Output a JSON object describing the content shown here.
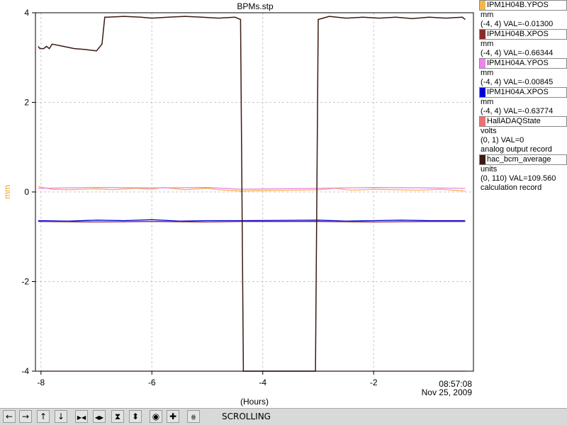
{
  "window": {
    "title": "BPMs.stp"
  },
  "chart_data": {
    "type": "line",
    "title": "BPMs.stp",
    "xlabel": "(Hours)",
    "ylabel": "mm",
    "xlim": [
      -8.1,
      -0.2
    ],
    "ylim": [
      -4,
      4
    ],
    "x_ticks": [
      "-8",
      "-6",
      "-4",
      "-2"
    ],
    "y_ticks": [
      "4",
      "2",
      "0",
      "-2",
      "-4"
    ],
    "time_label": "08:57:08",
    "date_label": "Nov 25, 2009",
    "grid": true,
    "series": [
      {
        "name": "IPM1H04B.YPOS",
        "color": "#f4b84a",
        "x": [
          -8.05,
          -7.8,
          -7.5,
          -7.0,
          -6.7,
          -6.3,
          -6.0,
          -5.8,
          -5.4,
          -5.0,
          -4.8,
          -4.4,
          -3.0,
          -2.7,
          -2.4,
          -2.0,
          -1.6,
          -1.2,
          -0.8,
          -0.35
        ],
        "y": [
          0.12,
          0.06,
          0.05,
          0.07,
          0.05,
          0.08,
          0.06,
          0.1,
          0.05,
          0.08,
          0.05,
          0.02,
          0.05,
          0.08,
          0.04,
          0.06,
          0.05,
          0.04,
          0.06,
          0.02
        ]
      },
      {
        "name": "IPM1H04B.XPOS",
        "color": "#8b2a2a",
        "x": [
          -8.05,
          -7.0,
          -6.0,
          -5.0,
          -4.4,
          -3.0,
          -2.0,
          -1.0,
          -0.35
        ],
        "y": [
          -0.66,
          -0.67,
          -0.66,
          -0.67,
          -0.66,
          -0.66,
          -0.67,
          -0.66,
          -0.66
        ]
      },
      {
        "name": "IPM1H04A.YPOS",
        "color": "#ee82ee",
        "x": [
          -8.05,
          -7.0,
          -6.0,
          -5.0,
          -4.4,
          -3.0,
          -2.0,
          -1.0,
          -0.35
        ],
        "y": [
          0.08,
          0.1,
          0.09,
          0.1,
          0.06,
          0.08,
          0.1,
          0.09,
          0.08
        ]
      },
      {
        "name": "IPM1H04A.XPOS",
        "color": "#0000dd",
        "x": [
          -8.05,
          -7.5,
          -7.0,
          -6.5,
          -6.0,
          -5.5,
          -5.0,
          -4.4,
          -3.0,
          -2.5,
          -2.0,
          -1.5,
          -1.0,
          -0.35
        ],
        "y": [
          -0.64,
          -0.65,
          -0.63,
          -0.64,
          -0.62,
          -0.65,
          -0.64,
          -0.64,
          -0.63,
          -0.65,
          -0.64,
          -0.63,
          -0.64,
          -0.64
        ]
      },
      {
        "name": "HallADAQState",
        "color": "#f07070",
        "x": [
          -8.05,
          -0.35
        ],
        "y": [
          -4,
          -4
        ]
      },
      {
        "name": "hac_bcm_average",
        "color": "#3a1a14",
        "x": [
          -8.05,
          -8.02,
          -7.95,
          -7.9,
          -7.85,
          -7.8,
          -7.6,
          -7.4,
          -7.2,
          -7.0,
          -6.9,
          -6.85,
          -6.8,
          -6.5,
          -6.2,
          -6.0,
          -5.7,
          -5.4,
          -5.1,
          -4.8,
          -4.5,
          -4.4,
          -4.35,
          -3.5,
          -3.05,
          -3.0,
          -2.8,
          -2.5,
          -2.2,
          -1.9,
          -1.6,
          -1.3,
          -1.0,
          -0.7,
          -0.4,
          -0.35
        ],
        "y": [
          3.25,
          3.2,
          3.2,
          3.25,
          3.2,
          3.3,
          3.25,
          3.2,
          3.18,
          3.15,
          3.3,
          3.9,
          3.9,
          3.92,
          3.9,
          3.88,
          3.9,
          3.92,
          3.9,
          3.88,
          3.9,
          3.85,
          -4,
          -4,
          -4,
          3.85,
          3.92,
          3.88,
          3.9,
          3.88,
          3.9,
          3.87,
          3.9,
          3.88,
          3.9,
          3.85
        ]
      }
    ]
  },
  "legend": {
    "entries": [
      {
        "name": "IPM1H04B.YPOS",
        "color": "#f4b84a",
        "lines": [
          "mm",
          "(-4, 4) VAL=-0.01300"
        ]
      },
      {
        "name": "IPM1H04B.XPOS",
        "color": "#8b2a2a",
        "lines": [
          "mm",
          "(-4, 4) VAL=-0.66344"
        ]
      },
      {
        "name": "IPM1H04A.YPOS",
        "color": "#ee82ee",
        "lines": [
          "mm",
          "(-4, 4) VAL=-0.00845"
        ]
      },
      {
        "name": "IPM1H04A.XPOS",
        "color": "#0000dd",
        "lines": [
          "mm",
          "(-4, 4) VAL=-0.63774"
        ]
      },
      {
        "name": "HallADAQState",
        "color": "#f07070",
        "lines": [
          "volts",
          "(0, 1) VAL=0",
          "analog output record"
        ]
      },
      {
        "name": "hac_bcm_average",
        "color": "#3a1a14",
        "lines": [
          "units",
          "(0, 110) VAL=109.560",
          "calculation record"
        ]
      }
    ]
  },
  "toolbar": {
    "status_text": "SCROLLING",
    "buttons": [
      {
        "name": "scroll-left-button",
        "glyph": "←"
      },
      {
        "name": "scroll-right-button",
        "glyph": "→"
      },
      {
        "name": "scroll-up-button",
        "glyph": "↑"
      },
      {
        "name": "scroll-down-button",
        "glyph": "↓"
      },
      {
        "name": "zoom-in-horizontal-button",
        "glyph": "▶◀"
      },
      {
        "name": "zoom-out-horizontal-button",
        "glyph": "◀▶"
      },
      {
        "name": "zoom-in-vertical-button",
        "glyph": "⧗"
      },
      {
        "name": "zoom-out-vertical-button",
        "glyph": "⬍"
      },
      {
        "name": "autoscale-button",
        "glyph": "◉"
      },
      {
        "name": "crosshair-button",
        "glyph": "✚"
      },
      {
        "name": "scroll-mode-button",
        "glyph": "⩷"
      }
    ]
  }
}
